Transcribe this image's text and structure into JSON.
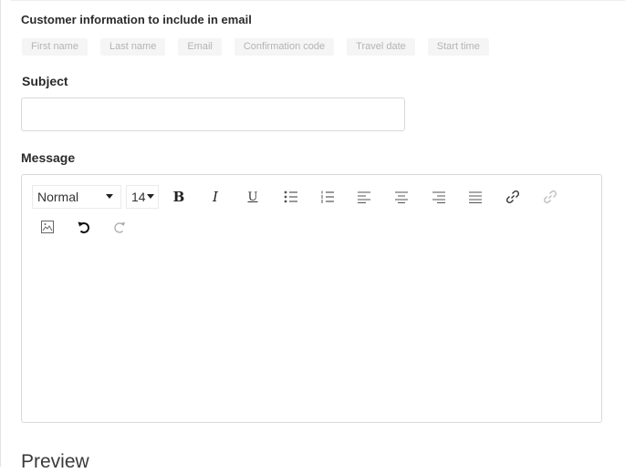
{
  "customer_info": {
    "heading": "Customer information to include in email",
    "tokens": [
      "First name",
      "Last name",
      "Email",
      "Confirmation code",
      "Travel date",
      "Start time"
    ]
  },
  "subject": {
    "label": "Subject",
    "value": ""
  },
  "message": {
    "label": "Message",
    "toolbar": {
      "format_value": "Normal",
      "size_value": "14",
      "bold": "B",
      "italic": "I",
      "underline": "U",
      "icons": [
        "bulleted-list-icon",
        "numbered-list-icon",
        "align-left-icon",
        "align-center-icon",
        "align-right-icon",
        "align-justify-icon",
        "link-icon",
        "unlink-icon",
        "image-icon",
        "undo-icon",
        "redo-icon"
      ]
    },
    "body": ""
  },
  "preview": {
    "heading": "Preview"
  }
}
